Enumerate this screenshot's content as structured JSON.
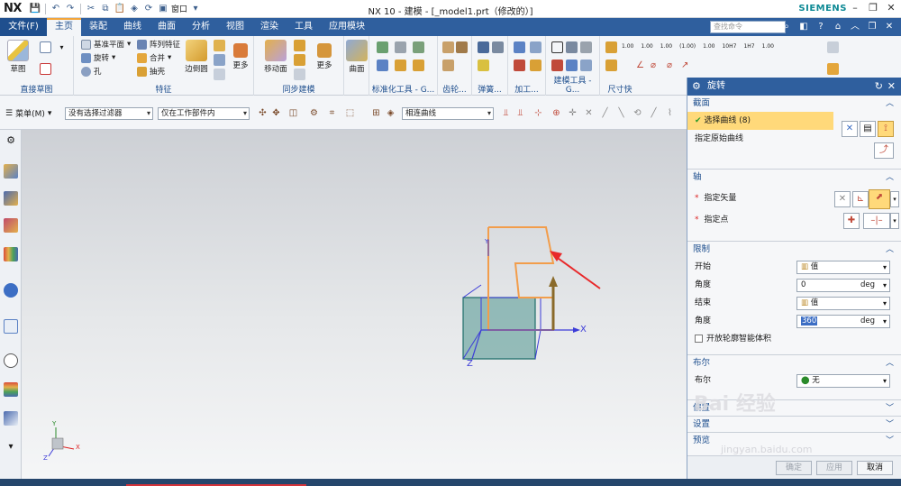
{
  "app": {
    "logo": "NX",
    "window_title": "NX 10 - 建模 - [_model1.prt（修改的）]",
    "brand": "SIEMENS",
    "window_menu": "窗口"
  },
  "tabs": {
    "file": "文件(F)",
    "items": [
      "主页",
      "装配",
      "曲线",
      "曲面",
      "分析",
      "视图",
      "渲染",
      "工具",
      "应用模块"
    ],
    "active_index": 0,
    "search_placeholder": "查找命令"
  },
  "ribbon": {
    "sketch": {
      "label": "草图",
      "group": "直接草图"
    },
    "feature": {
      "group": "特征",
      "datum": "基准平面",
      "revolve": "旋转",
      "hole": "孔",
      "pattern": "阵列特征",
      "unite": "合并",
      "shell": "抽壳",
      "edge_blend": "边倒圆",
      "more": "更多"
    },
    "sync": {
      "group": "同步建模",
      "move_face": "移动面",
      "more": "更多"
    },
    "surface": {
      "label": "曲面"
    },
    "std": "标准化工具 - G...",
    "gear": "齿轮...",
    "spring": "弹簧...",
    "machining": "加工...",
    "modeling_tool": "建模工具 - G...",
    "dim": "尺寸快",
    "tol_labels": [
      "1.00",
      "1.00",
      "1.00",
      "(1.00)",
      "1.00",
      "10H7",
      "1H7",
      "1.00"
    ]
  },
  "selection_bar": {
    "menu": "菜单(M)",
    "filter": "没有选择过滤器",
    "scope": "仅在工作部件内",
    "curve_rule": "相连曲线"
  },
  "viewport": {
    "axis_x": "X",
    "axis_y": "Y",
    "axis_z": "Z",
    "triad_x": "X",
    "triad_y": "Y",
    "triad_z": "Z"
  },
  "dialog": {
    "title": "旋转",
    "section": {
      "title": "截面",
      "select_curve": "选择曲线 (8)",
      "specify_origin": "指定原始曲线"
    },
    "axis": {
      "title": "轴",
      "vector": "指定矢量",
      "point": "指定点"
    },
    "limits": {
      "title": "限制",
      "start_label": "开始",
      "start_value": "值",
      "start_angle_label": "角度",
      "start_angle": "0",
      "end_label": "结束",
      "end_value": "值",
      "end_angle_label": "角度",
      "end_angle": "360",
      "unit": "deg",
      "open_profile": "开放轮廓智能体积"
    },
    "boolean": {
      "title": "布尔",
      "label": "布尔",
      "value": "无"
    },
    "offset": {
      "title": "偏置"
    },
    "settings": {
      "title": "设置"
    },
    "preview": {
      "title": "预览"
    },
    "buttons": {
      "ok": "确定",
      "apply": "应用",
      "cancel": "取消"
    }
  },
  "watermark": {
    "main": "Bai 经验",
    "sub": "jingyan.baidu.com"
  },
  "colors": {
    "accent": "#2f5f9e",
    "highlight": "#ffd97a",
    "arrow_red": "#e8282a",
    "curve_orange": "#f29d4b"
  }
}
